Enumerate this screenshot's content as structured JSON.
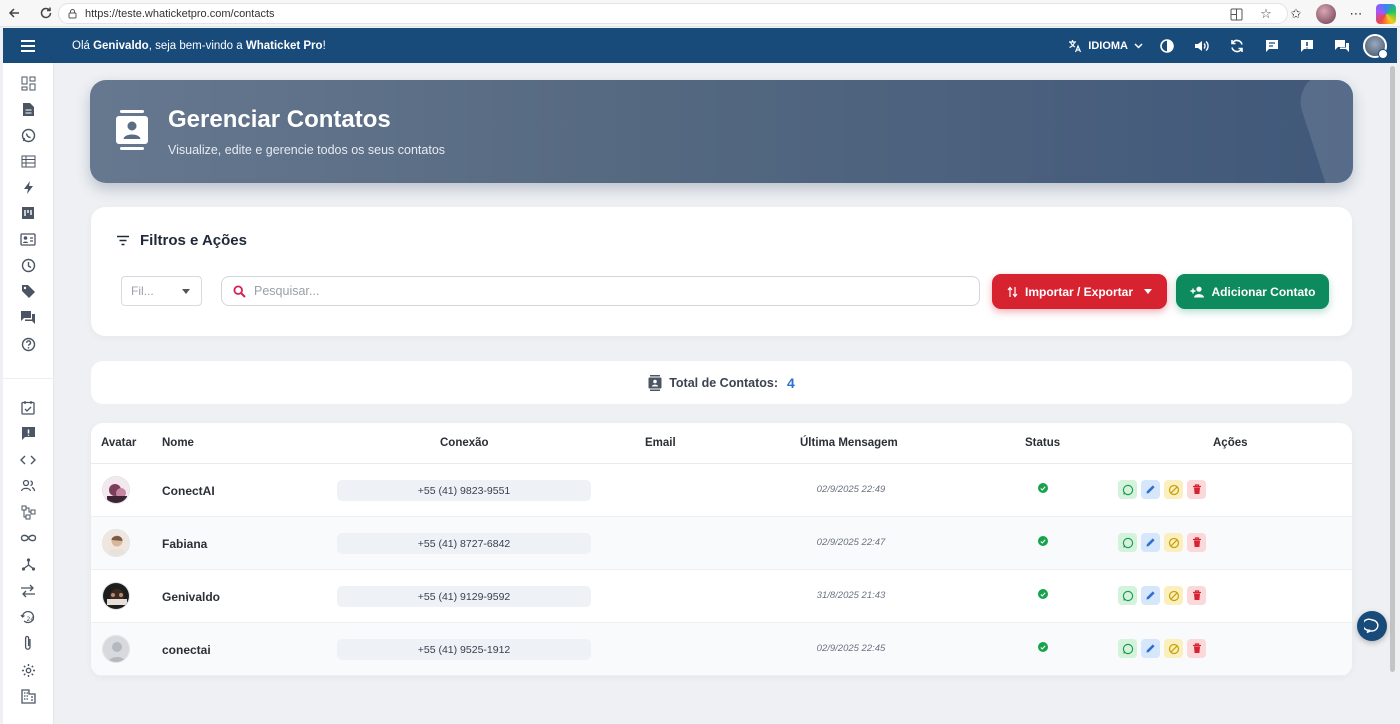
{
  "browser": {
    "url": "https://teste.whaticketpro.com/contacts"
  },
  "topbar": {
    "greeting_prefix": "Olá ",
    "user_name": "Genivaldo",
    "greeting_middle": ", seja bem-vindo a ",
    "app_name": "Whaticket Pro",
    "greeting_suffix": "!",
    "language_label": "IDIOMA"
  },
  "header": {
    "title": "Gerenciar Contatos",
    "subtitle": "Visualize, edite e gerencie todos os seus contatos"
  },
  "filters": {
    "title": "Filtros e Ações",
    "select_placeholder": "Fil...",
    "search_placeholder": "Pesquisar...",
    "import_export_label": "Importar / Exportar",
    "add_contact_label": "Adicionar Contato"
  },
  "summary": {
    "total_label": "Total de Contatos:",
    "total_count": "4"
  },
  "table": {
    "headers": {
      "avatar": "Avatar",
      "name": "Nome",
      "connection": "Conexão",
      "email": "Email",
      "last_message": "Última Mensagem",
      "status": "Status",
      "actions": "Ações"
    },
    "rows": [
      {
        "name": "ConectAI",
        "connection": "+55 (41) 9823-9551",
        "email": "",
        "last_message": "02/9/2025 22:49",
        "status": "active"
      },
      {
        "name": "Fabiana",
        "connection": "+55 (41) 8727-6842",
        "email": "",
        "last_message": "02/9/2025 22:47",
        "status": "active"
      },
      {
        "name": "Genivaldo",
        "connection": "+55 (41) 9129-9592",
        "email": "",
        "last_message": "31/8/2025 21:43",
        "status": "active"
      },
      {
        "name": "conectai",
        "connection": "+55 (41) 9525-1912",
        "email": "",
        "last_message": "02/9/2025 22:45",
        "status": "active"
      }
    ]
  },
  "colors": {
    "topbar": "#184a7a",
    "import_button": "#d72230",
    "add_button": "#0e8a5f",
    "status_ok": "#16a34a",
    "count_accent": "#2f6fd0"
  }
}
